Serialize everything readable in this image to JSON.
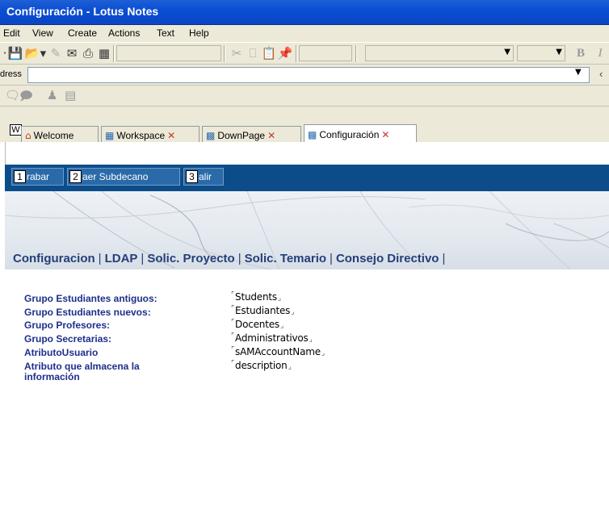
{
  "window": {
    "title": "Configuración  - Lotus Notes"
  },
  "menu": [
    {
      "label": "Edit"
    },
    {
      "label": "View"
    },
    {
      "label": "Create"
    },
    {
      "label": "Actions"
    },
    {
      "label": "Text"
    },
    {
      "label": "Help"
    }
  ],
  "toolbar": {
    "icons": [
      "save-icon",
      "open-icon",
      "edit-icon",
      "send-icon",
      "print-icon",
      "preview-icon",
      "cut-icon",
      "copy-icon",
      "paste-icon",
      "paste-special-icon"
    ],
    "format": {
      "bold_label": "B",
      "italic_label": "I"
    }
  },
  "address": {
    "label": "dress",
    "value": ""
  },
  "tabs": [
    {
      "label": "Welcome",
      "icon": "home-icon",
      "closable": false
    },
    {
      "label": "Workspace",
      "icon": "workspace-icon",
      "closable": true
    },
    {
      "label": "DownPage",
      "icon": "page-icon",
      "closable": true
    },
    {
      "label": "Configuración",
      "icon": "page-icon",
      "closable": true,
      "active": true
    }
  ],
  "shortcut_badge": "W",
  "actions": [
    {
      "number": "1",
      "label": "rabar"
    },
    {
      "number": "2",
      "label": "aer Subdecano"
    },
    {
      "number": "3",
      "label": "alir"
    }
  ],
  "section_tabs": [
    "Configuracion",
    "LDAP",
    "Solic. Proyecto",
    "Solic. Temario",
    "Consejo Directivo"
  ],
  "fields": [
    {
      "label": "Grupo Estudiantes antiguos:",
      "value": "Students"
    },
    {
      "label": "Grupo Estudiantes nuevos:",
      "value": "Estudiantes"
    },
    {
      "label": "Grupo Profesores:",
      "value": "Docentes"
    },
    {
      "label": "Grupo Secretarias:",
      "value": "Administrativos"
    },
    {
      "label": "AtributoUsuario",
      "value": "sAMAccountName"
    },
    {
      "label": "Atributo que almacena la",
      "label2": "información",
      "value": "description"
    }
  ],
  "colors": {
    "titlebar": "#0a45c4",
    "actionbar": "#0c4d89",
    "label": "#1d2f8a",
    "tab_text": "#233f7a"
  }
}
